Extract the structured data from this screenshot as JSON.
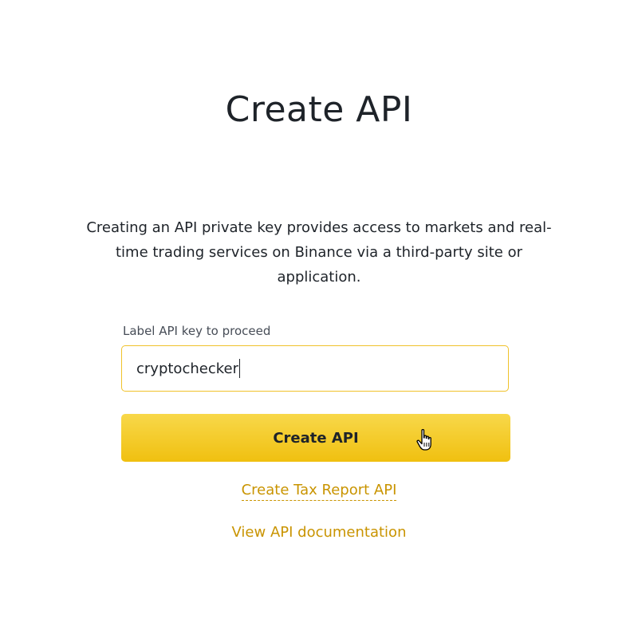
{
  "page": {
    "title": "Create API",
    "description": "Creating an API private key provides access to markets and real-time trading services on Binance via a third-party site or application."
  },
  "form": {
    "label": "Label API key to proceed",
    "input_value": "cryptochecker",
    "submit_label": "Create API"
  },
  "links": {
    "tax_report": "Create Tax Report API",
    "documentation": "View API documentation"
  },
  "colors": {
    "accent": "#f0c22b",
    "button": "#f0c010",
    "link": "#c99400",
    "text": "#1e2329"
  },
  "icons": {
    "cursor": "hand-pointer-icon"
  }
}
